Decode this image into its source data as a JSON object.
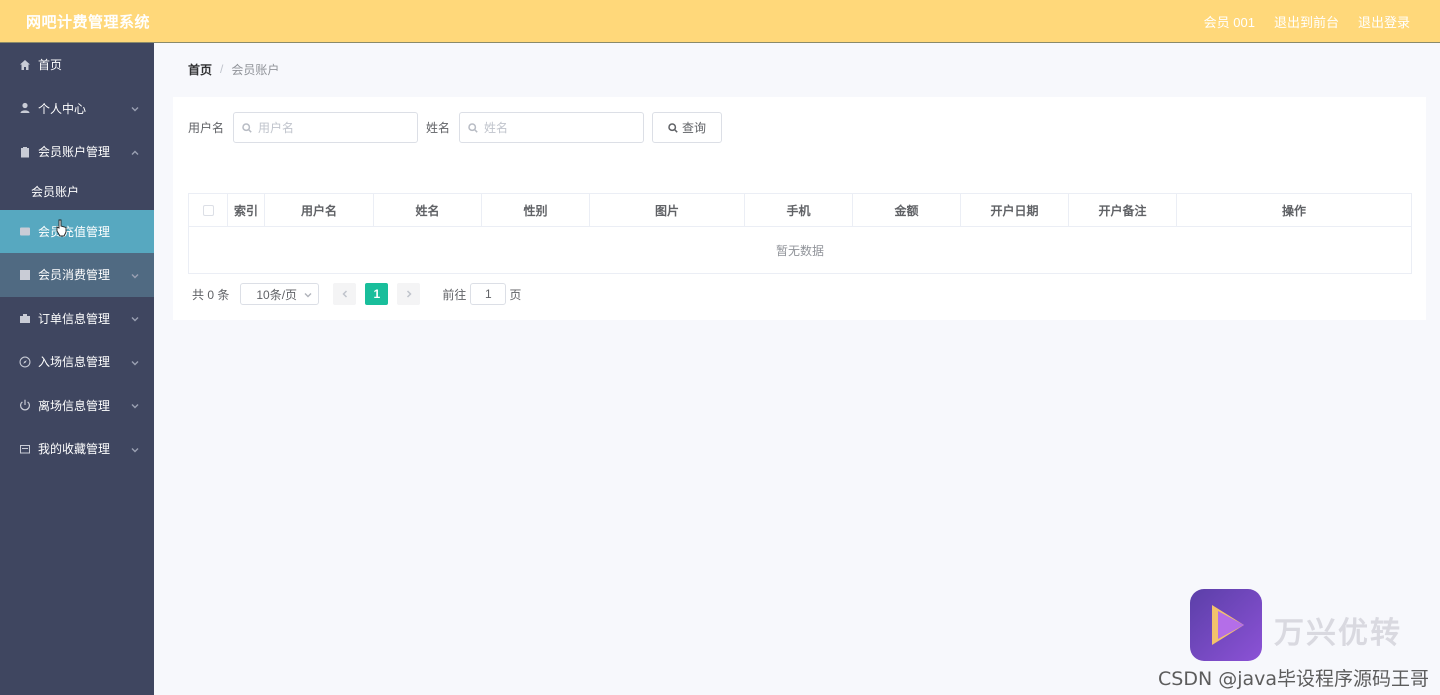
{
  "app_title": "网吧计费管理系统",
  "top_links": {
    "user": "会员 001",
    "front": "退出到前台",
    "logout": "退出登录"
  },
  "sidebar": {
    "items": [
      {
        "label": "首页",
        "icon": "home-icon"
      },
      {
        "label": "个人中心",
        "icon": "user-icon"
      },
      {
        "label": "会员账户管理",
        "icon": "clipboard-icon",
        "expanded": true,
        "children": [
          {
            "label": "会员账户"
          }
        ]
      },
      {
        "label": "会员充值管理",
        "icon": "wallet-icon"
      },
      {
        "label": "会员消费管理",
        "icon": "chart-icon"
      },
      {
        "label": "订单信息管理",
        "icon": "cart-icon"
      },
      {
        "label": "入场信息管理",
        "icon": "compass-icon"
      },
      {
        "label": "离场信息管理",
        "icon": "power-icon"
      },
      {
        "label": "我的收藏管理",
        "icon": "folder-icon"
      }
    ]
  },
  "breadcrumb": {
    "home": "首页",
    "separator": "/",
    "current": "会员账户"
  },
  "search": {
    "username_label": "用户名",
    "username_placeholder": "用户名",
    "name_label": "姓名",
    "name_placeholder": "姓名",
    "query_button": "查询"
  },
  "table": {
    "columns": [
      "索引",
      "用户名",
      "姓名",
      "性别",
      "图片",
      "手机",
      "金额",
      "开户日期",
      "开户备注",
      "操作"
    ],
    "empty_text": "暂无数据"
  },
  "pagination": {
    "total": "共 0 条",
    "page_size": "10条/页",
    "current_page": "1",
    "goto_label": "前往",
    "goto_value": "1",
    "page_suffix": "页"
  },
  "watermark": {
    "brand": "万兴优转",
    "csdn": "CSDN @java毕设程序源码王哥"
  },
  "colors": {
    "topbar": "#ffd87a",
    "sidebar": "#3f4660",
    "active_menu": "#57a8c0",
    "pager_active": "#19be9b"
  }
}
